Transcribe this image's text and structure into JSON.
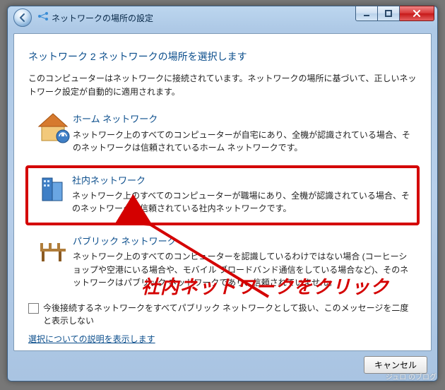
{
  "window": {
    "title": "ネットワークの場所の設定"
  },
  "heading": "ネットワーク 2 ネットワークの場所を選択します",
  "intro": "このコンピューターはネットワークに接続されています。ネットワークの場所に基づいて、正しいネットワーク設定が自動的に適用されます。",
  "options": {
    "home": {
      "title": "ホーム ネットワーク",
      "desc": "ネットワーク上のすべてのコンピューターが自宅にあり、全機が認識されている場合、そのネットワークは信頼されているホーム ネットワークです。"
    },
    "work": {
      "title": "社内ネットワーク",
      "desc": "ネットワーク上のすべてのコンピューターが職場にあり、全機が認識されている場合、そのネットワークは信頼されている社内ネットワークです。"
    },
    "public": {
      "title": "パブリック ネットワーク",
      "desc": "ネットワーク上のすべてのコンピューターを認識しているわけではない場合 (コーヒーショップや空港にいる場合や、モバイル ブロードバンド通信をしている場合など)、そのネットワークはパブリック ネットワークであり、信頼されていません。"
    }
  },
  "checkbox_label": "今後接続するネットワークをすべてパブリック ネットワークとして扱い、このメッセージを二度と表示しない",
  "help_link": "選択についての説明を表示します",
  "cancel_label": "キャンセル",
  "annotation": "社内ネットワークをクリック",
  "watermark": "ジュロ のブログ"
}
